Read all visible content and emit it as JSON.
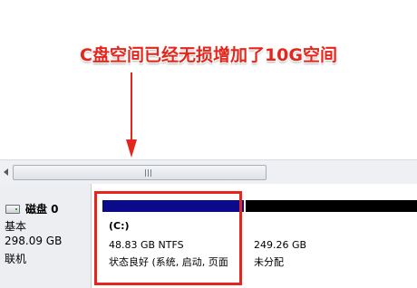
{
  "annotation": {
    "text": "C盘空间已经无损增加了10G空间",
    "color": "#e4261c"
  },
  "disk": {
    "name": "磁盘 0",
    "type": "基本",
    "size": "298.09 GB",
    "status": "联机"
  },
  "partitions": [
    {
      "label": "(C:)",
      "size": "48.83 GB NTFS",
      "status": "状态良好 (系统, 启动, 页面",
      "bar_color": "#0a0a8a"
    },
    {
      "size": "249.26 GB",
      "status": "未分配",
      "bar_color": "#000000"
    }
  ],
  "icons": {
    "disk": "disk-icon",
    "scroll_left": "scroll-left-arrow-icon",
    "grip": "scrollbar-grip-icon",
    "pointer": "arrow-down-icon"
  }
}
